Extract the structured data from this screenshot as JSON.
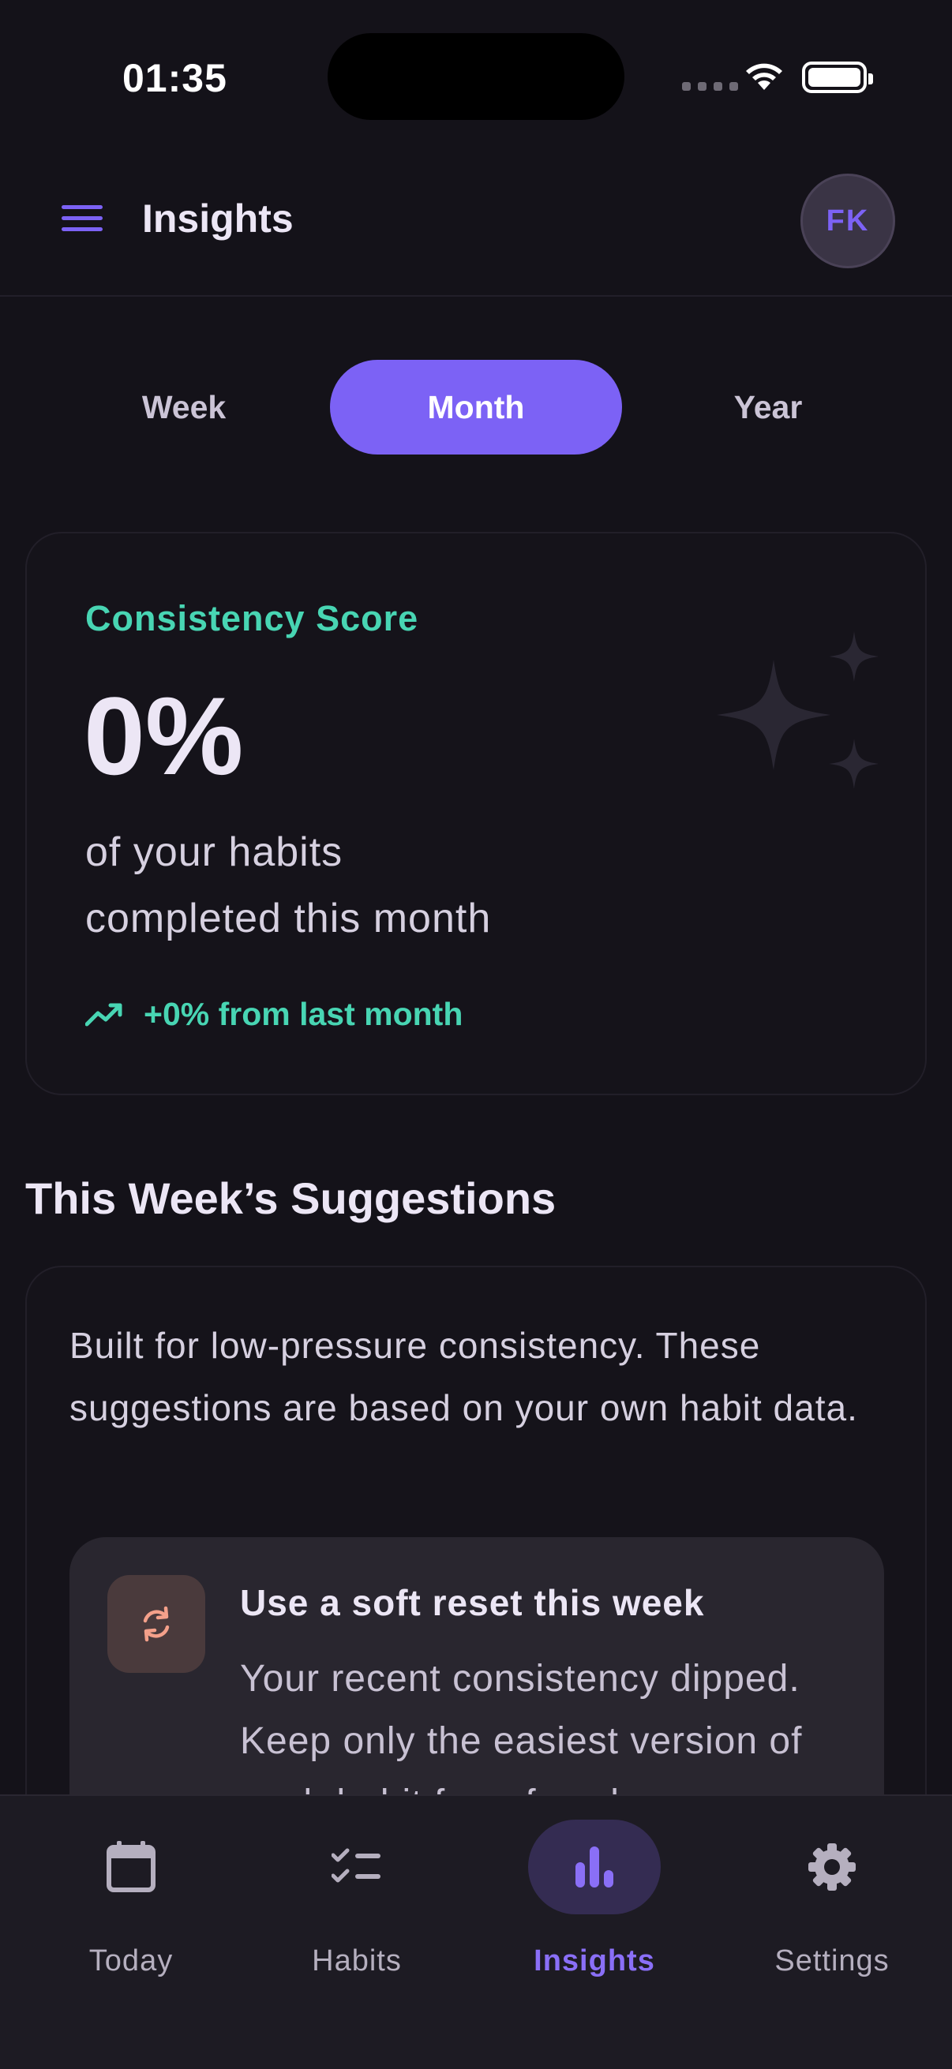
{
  "status_bar": {
    "time": "01:35"
  },
  "header": {
    "title": "Insights",
    "avatar_initials": "FK"
  },
  "period_tabs": [
    {
      "label": "Week",
      "selected": false
    },
    {
      "label": "Month",
      "selected": true
    },
    {
      "label": "Year",
      "selected": false
    }
  ],
  "consistency": {
    "label": "Consistency Score",
    "value": "0%",
    "description_line1": "of your habits",
    "description_line2": "completed this month",
    "trend": "+0% from last month"
  },
  "suggestions": {
    "title": "This Week’s Suggestions",
    "intro": "Built for low-pressure consistency. These suggestions are based on your own habit data.",
    "tip": {
      "title": "Use a soft reset this week",
      "body": "Your recent consistency dipped. Keep only the easiest version of each habit for a few days so"
    }
  },
  "bottom_nav": [
    {
      "label": "Today",
      "icon": "calendar-icon",
      "active": false
    },
    {
      "label": "Habits",
      "icon": "checklist-icon",
      "active": false
    },
    {
      "label": "Insights",
      "icon": "bar-chart-icon",
      "active": true
    },
    {
      "label": "Settings",
      "icon": "gear-icon",
      "active": false
    }
  ],
  "colors": {
    "background": "#141219",
    "accent": "#7c62f5",
    "teal": "#48d5b3",
    "tip_icon": "#f4a08a"
  }
}
